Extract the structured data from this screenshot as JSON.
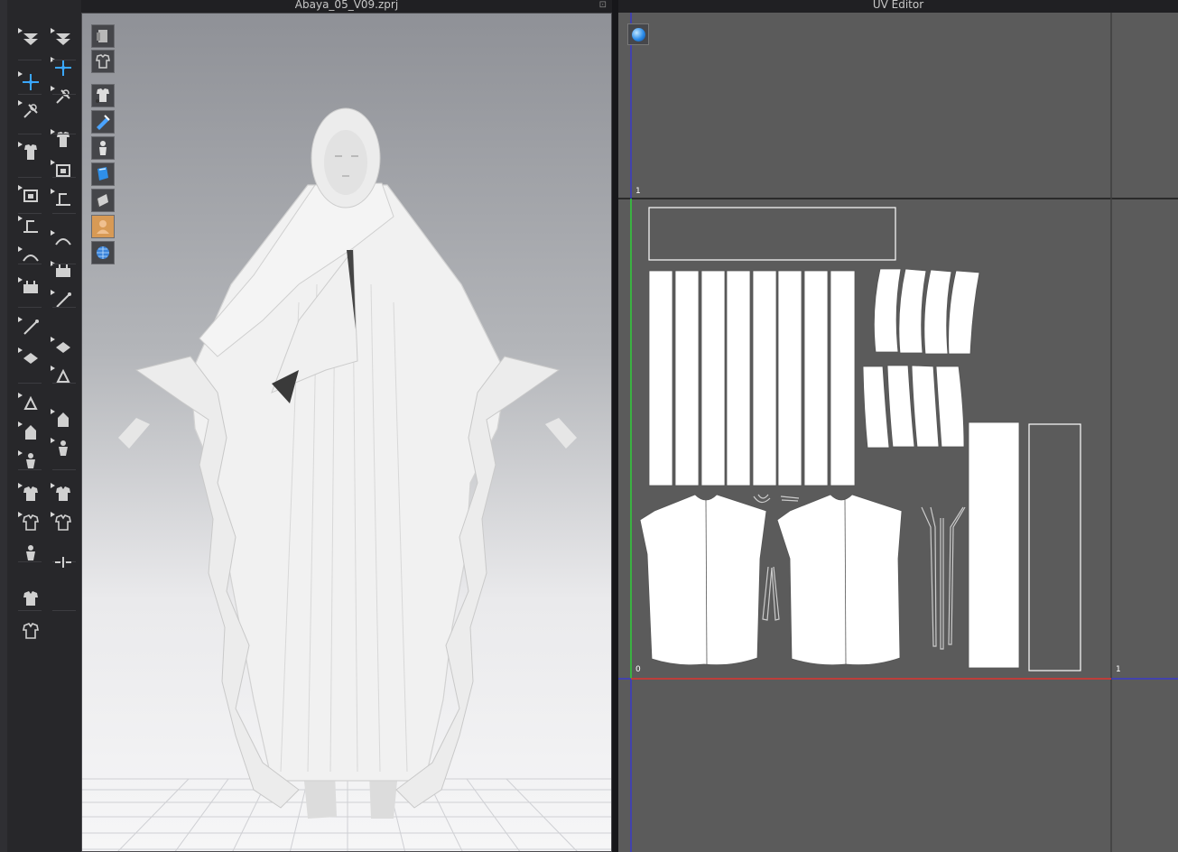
{
  "viewport": {
    "title": "Abaya_05_V09.zprj",
    "pin_glyph": "⊡",
    "buttons": [
      "avatar-display-icon",
      "garment-display-icon",
      "show-garment-icon",
      "show-pins-icon",
      "show-avatar-icon",
      "texture-surface-icon",
      "thickness-icon",
      "avatar-skin-icon",
      "world-grid-icon"
    ]
  },
  "uv_editor": {
    "title": "UV Editor",
    "axis_labels": {
      "top_one": "1",
      "origin": "0",
      "right_one": "1"
    },
    "axis_colors": {
      "u_axis": "#e0342f",
      "v_axis": "#2fcf3a",
      "grid": "#1a1a1a",
      "left_blue": "#2a2aff"
    }
  },
  "toolbar_left": {
    "col1": [
      "fold-arrangement-icon",
      "transform-pattern-icon",
      "edit-pattern-icon",
      "simulation-icon",
      "garment-fit-icon",
      "segment-icon",
      "internal-line-icon",
      "sewing-icon",
      "measure-icon",
      "tape-icon",
      "fold-icon",
      "pin-icon",
      "avatar-icon",
      "shirt-front-icon",
      "shirt-back-icon"
    ],
    "col2": [
      "select-mesh-icon",
      "select-move-icon",
      "edit-texture-icon",
      "transform-graphic-icon",
      "select-pattern-icon",
      "trim-icon",
      "button-icon",
      "buttonhole-icon",
      "zipper-icon",
      "zipper-puller-icon",
      "topstitch-icon",
      "puckering-icon",
      "padding-icon",
      "fold-fabric-icon",
      "tack-icon"
    ]
  }
}
